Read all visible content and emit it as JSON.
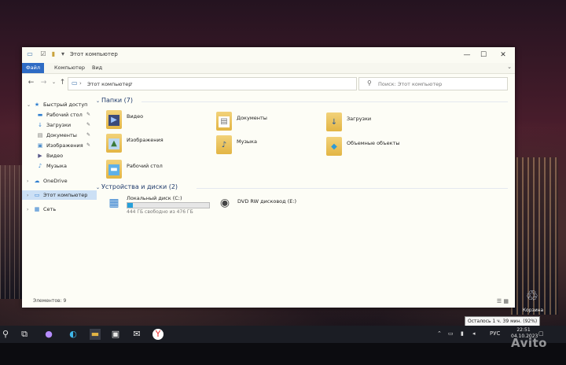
{
  "window": {
    "title": "Этот компьютер",
    "controls": {
      "minimize": "—",
      "maximize": "☐",
      "close": "✕"
    }
  },
  "ribbon": {
    "tabs": [
      "Файл",
      "Компьютер",
      "Вид"
    ],
    "expand": "⌄"
  },
  "address": {
    "path": "Этот компьютер",
    "separator": "›",
    "search_placeholder": "Поиск: Этот компьютер"
  },
  "sidebar": {
    "quick_access": "Быстрый доступ",
    "quick_items": [
      "Рабочий стол",
      "Загрузки",
      "Документы",
      "Изображения",
      "Видео",
      "Музыка"
    ],
    "onedrive": "OneDrive",
    "this_pc": "Этот компьютер",
    "network": "Сеть"
  },
  "folders_group": "Папки (7)",
  "folders": [
    {
      "label": "Видео",
      "icon": "video-icon"
    },
    {
      "label": "Документы",
      "icon": "document-icon"
    },
    {
      "label": "Загрузки",
      "icon": "download-icon"
    },
    {
      "label": "Изображения",
      "icon": "image-icon"
    },
    {
      "label": "Музыка",
      "icon": "music-icon"
    },
    {
      "label": "Объемные объекты",
      "icon": "cube-icon"
    },
    {
      "label": "Рабочий стол",
      "icon": "desktop-icon"
    }
  ],
  "devices_group": "Устройства и диски (2)",
  "drives": [
    {
      "name": "Локальный диск (C:)",
      "free": "444 ГБ свободно из 476 ГБ",
      "used_fraction": 0.067
    },
    {
      "name": "DVD RW дисковод (E:)"
    }
  ],
  "status": {
    "items": "Элементов: 9"
  },
  "desktop": {
    "recycle_bin": "Корзина"
  },
  "battery_tooltip": "Осталось 1 ч. 39 мин. (92%)",
  "tray": {
    "lang": "РУС",
    "time": "22:51",
    "date": "04.10.2023"
  },
  "watermark": "Avito"
}
